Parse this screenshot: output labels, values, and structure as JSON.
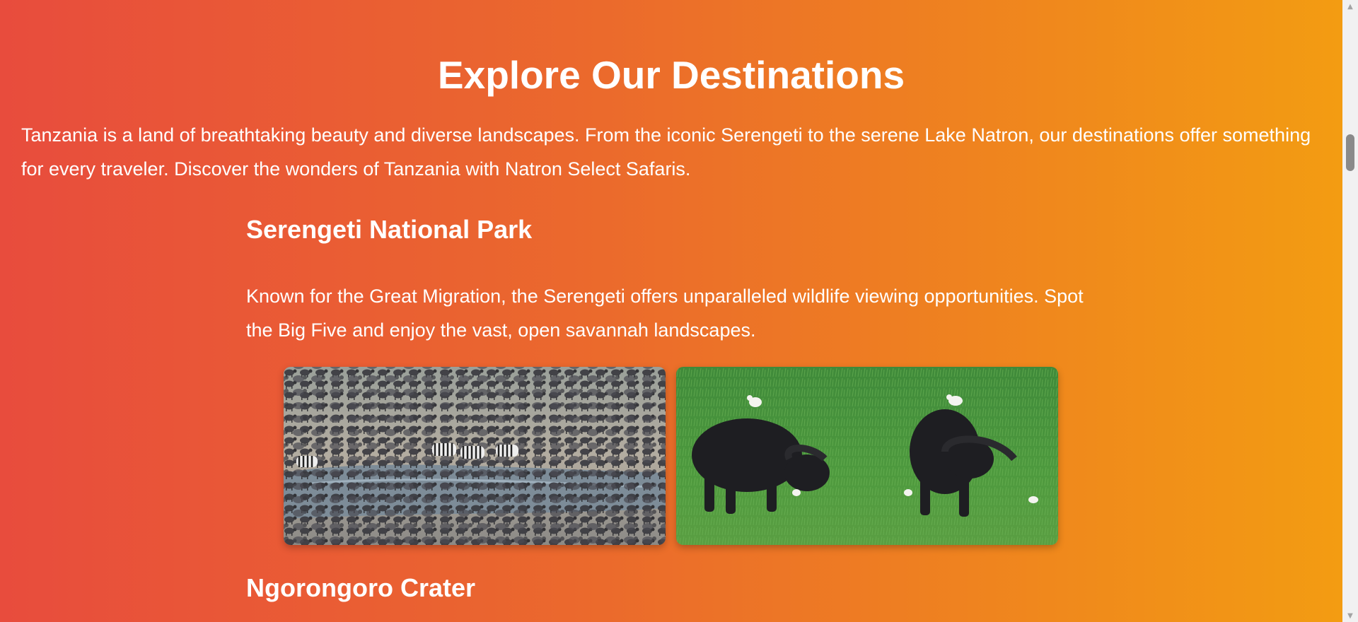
{
  "page": {
    "title": "Explore Our Destinations",
    "intro": "Tanzania is a land of breathtaking beauty and diverse landscapes. From the iconic Serengeti to the serene Lake Natron, our destinations offer something for every traveler. Discover the wonders of Tanzania with Natron Select Safaris."
  },
  "destinations": [
    {
      "name": "Serengeti National Park",
      "description": "Known for the Great Migration, the Serengeti offers unparalleled wildlife viewing opportunities. Spot the Big Five and enjoy the vast, open savannah landscapes.",
      "images": [
        {
          "subject": "wildebeest-zebra-herd-at-river"
        },
        {
          "subject": "cape-buffalo-with-egrets"
        }
      ]
    },
    {
      "name": "Ngorongoro Crater"
    }
  ],
  "colors": {
    "gradient_start": "#e84c3d",
    "gradient_end": "#f39c12",
    "text": "#ffffff"
  },
  "icons": {
    "scroll_up": "triangle-up-icon",
    "scroll_down": "triangle-down-icon"
  }
}
